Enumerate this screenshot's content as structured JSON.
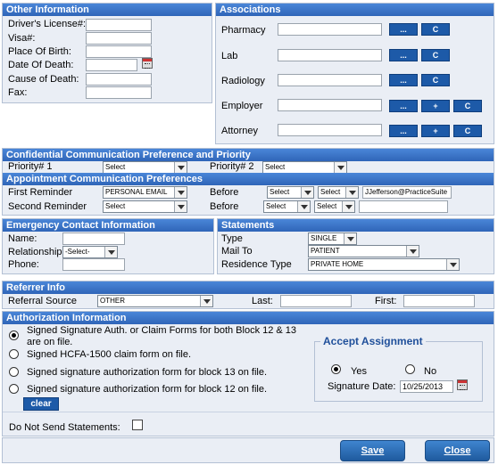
{
  "other_info": {
    "title": "Other Information",
    "fields": [
      {
        "label": "Driver's License#:",
        "value": ""
      },
      {
        "label": "Visa#:",
        "value": ""
      },
      {
        "label": "Place Of Birth:",
        "value": ""
      },
      {
        "label": "Date Of Death:",
        "value": ""
      },
      {
        "label": "Cause of Death:",
        "value": ""
      },
      {
        "label": "Fax:",
        "value": ""
      }
    ]
  },
  "associations": {
    "title": "Associations",
    "rows": [
      {
        "label": "Pharmacy",
        "value": "",
        "browse": "...",
        "plus": "",
        "clear": "C"
      },
      {
        "label": "Lab",
        "value": "",
        "browse": "...",
        "plus": "",
        "clear": "C"
      },
      {
        "label": "Radiology",
        "value": "",
        "browse": "...",
        "plus": "",
        "clear": "C"
      },
      {
        "label": "Employer",
        "value": "",
        "browse": "...",
        "plus": "+",
        "clear": "C"
      },
      {
        "label": "Attorney",
        "value": "",
        "browse": "...",
        "plus": "+",
        "clear": "C"
      }
    ]
  },
  "confidential": {
    "title": "Confidential Communication Preference and Priority",
    "priority1_label": "Priority# 1",
    "priority1_value": "Select",
    "priority2_label": "Priority# 2",
    "priority2_value": "Select"
  },
  "appointment": {
    "title": "Appointment Communication Preferences",
    "first_label": "First Reminder",
    "first_value": "PERSONAL EMAIL",
    "first_before_label": "Before",
    "first_before_1": "Select",
    "first_before_2": "Select",
    "first_address": "JJefferson@PracticeSuite",
    "second_label": "Second Reminder",
    "second_value": "Select",
    "second_before_label": "Before",
    "second_before_1": "Select",
    "second_before_2": "Select",
    "second_address": ""
  },
  "emergency": {
    "title": "Emergency Contact Information",
    "name_label": "Name:",
    "name_value": "",
    "relationship_label": "Relationship",
    "relationship_value": "-Select-",
    "phone_label": "Phone:",
    "phone_value": ""
  },
  "statements": {
    "title": "Statements",
    "type_label": "Type",
    "type_value": "SINGLE",
    "mailto_label": "Mail To",
    "mailto_value": "PATIENT",
    "residence_label": "Residence Type",
    "residence_value": "PRIVATE HOME"
  },
  "referrer": {
    "title": "Referrer Info",
    "source_label": "Referral Source",
    "source_value": "OTHER",
    "last_label": "Last:",
    "last_value": "",
    "first_label": "First:",
    "first_value": ""
  },
  "authorization": {
    "title": "Authorization Information",
    "options": [
      {
        "line1": "Signed Signature Auth. or Claim Forms for both Block 12 & 13",
        "line2": "are on file.",
        "selected": true
      },
      {
        "line1": "Signed HCFA-1500 claim form on file.",
        "line2": "",
        "selected": false
      },
      {
        "line1": "Signed signature authorization form for block 13 on file.",
        "line2": "",
        "selected": false
      },
      {
        "line1": "Signed signature authorization form for block 12 on file.",
        "line2": "",
        "selected": false
      }
    ],
    "clear_label": "clear",
    "accept_title": "Accept Assignment",
    "yes_label": "Yes",
    "no_label": "No",
    "accept_selected": "Yes",
    "sig_date_label": "Signature Date:",
    "sig_date_value": "10/25/2013",
    "no_statements_label": "Do Not Send Statements:"
  },
  "footer": {
    "save_label": "Save",
    "close_label": "Close"
  },
  "colors": {
    "header_blue": "#3a74c8",
    "panel_bg": "#eaeef5",
    "button_blue": "#1d5aa8"
  }
}
